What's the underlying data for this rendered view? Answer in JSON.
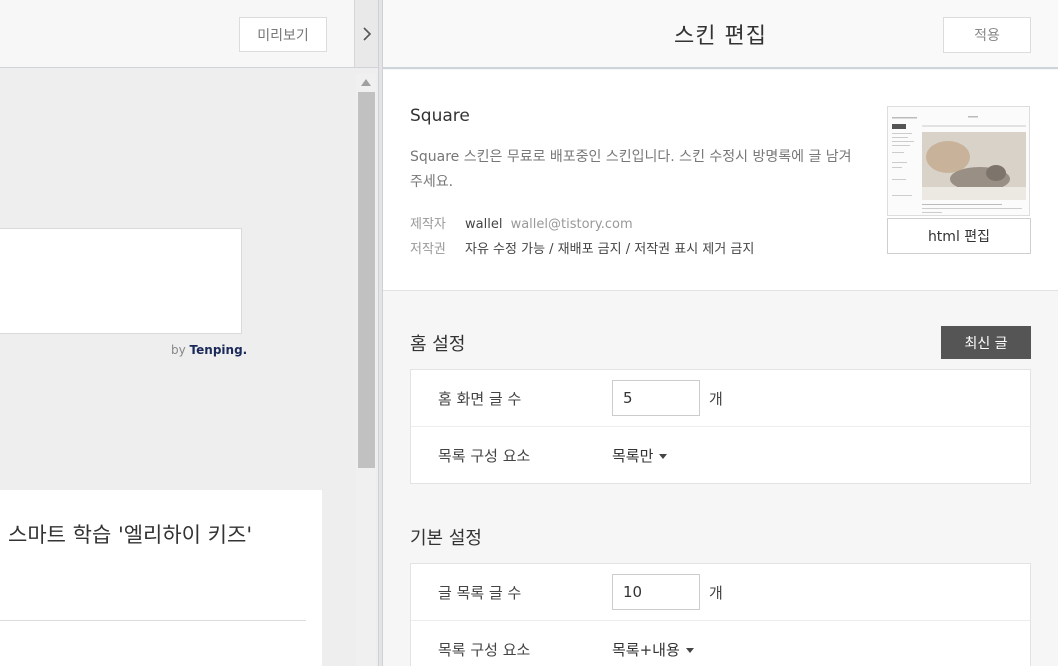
{
  "preview_pane": {
    "preview_label": "미리보기",
    "ad_by_prefix": "by",
    "ad_brand": "Tenping.",
    "post_title": "스마트 학습 '엘리하이 키즈'"
  },
  "editor": {
    "title": "스킨 편집",
    "apply_label": "적용",
    "skin": {
      "name": "Square",
      "description": "Square 스킨은 무료로 배포중인 스킨입니다. 스킨 수정시 방명록에 글 남겨주세요.",
      "author_key": "제작자",
      "author_name": "wallel",
      "author_email": "wallel@tistory.com",
      "license_key": "저작권",
      "license_value": "자유 수정 가능 / 재배포 금지 / 저작권 표시 제거 금지",
      "html_edit_label": "html 편집"
    },
    "home_settings": {
      "title": "홈 설정",
      "latest_label": "최신 글",
      "rows": [
        {
          "label": "홈 화면 글 수",
          "value": "5",
          "unit": "개"
        },
        {
          "label": "목록 구성 요소",
          "select": "목록만"
        }
      ]
    },
    "basic_settings": {
      "title": "기본 설정",
      "rows": [
        {
          "label": "글 목록 글 수",
          "value": "10",
          "unit": "개"
        },
        {
          "label": "목록 구성 요소",
          "select": "목록+내용"
        }
      ]
    }
  }
}
